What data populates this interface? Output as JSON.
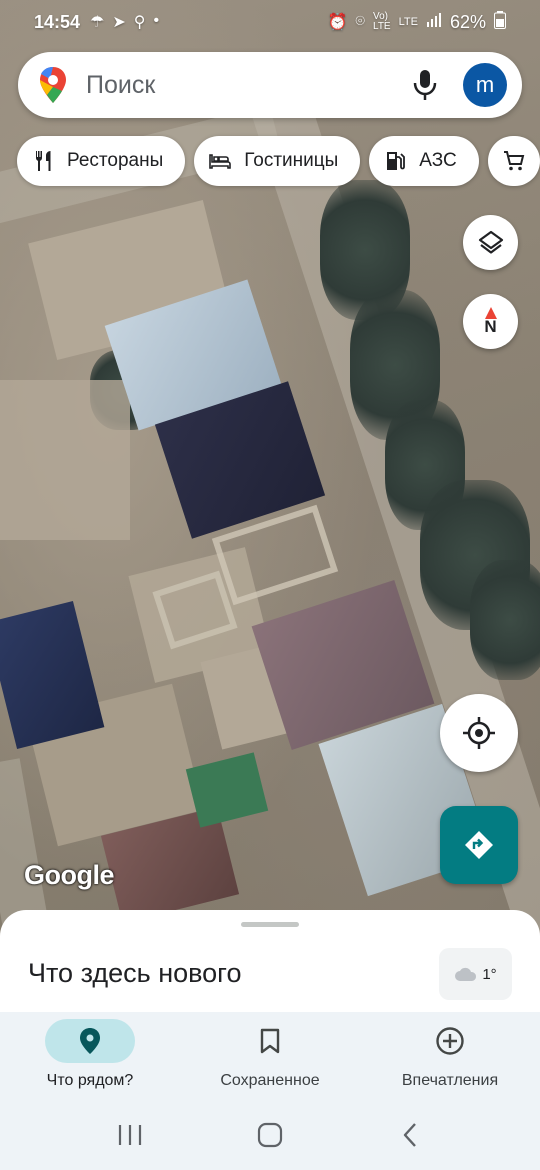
{
  "status_bar": {
    "time": "14:54",
    "battery": "62%",
    "network": "LTE",
    "icons_left": [
      "umbrella-icon",
      "telegram-icon",
      "search-icon",
      "dot-icon"
    ],
    "icons_right": [
      "alarm-icon",
      "location-icon",
      "volte-icon",
      "lte-icon",
      "signal-icon",
      "battery-icon"
    ]
  },
  "search": {
    "placeholder": "Поиск",
    "avatar_letter": "m",
    "icons": [
      "maps-pin-icon",
      "mic-icon"
    ]
  },
  "chips": [
    {
      "label": "Рестораны",
      "icon": "restaurant-icon"
    },
    {
      "label": "Гостиницы",
      "icon": "hotel-icon"
    },
    {
      "label": "АЗС",
      "icon": "gas-station-icon"
    },
    {
      "label": "",
      "icon": "shopping-cart-icon"
    }
  ],
  "map_controls": {
    "compass_label": "N",
    "icons": [
      "layers-icon",
      "compass-icon",
      "my-location-icon",
      "directions-icon"
    ]
  },
  "map": {
    "logo_text": "Google"
  },
  "sheet": {
    "title": "Что здесь нового",
    "weather_temp": "1°",
    "weather_icon": "cloud-icon"
  },
  "bottom_nav": [
    {
      "label": "Что рядом?",
      "icon": "place-pin-icon",
      "active": true
    },
    {
      "label": "Сохраненное",
      "icon": "bookmark-icon",
      "active": false
    },
    {
      "label": "Впечатления",
      "icon": "add-circle-icon",
      "active": false
    }
  ],
  "colors": {
    "accent": "#037c82",
    "avatar": "#0b57a4",
    "active_pill": "#bfe5ea",
    "nav_bg": "#eef3f7"
  }
}
